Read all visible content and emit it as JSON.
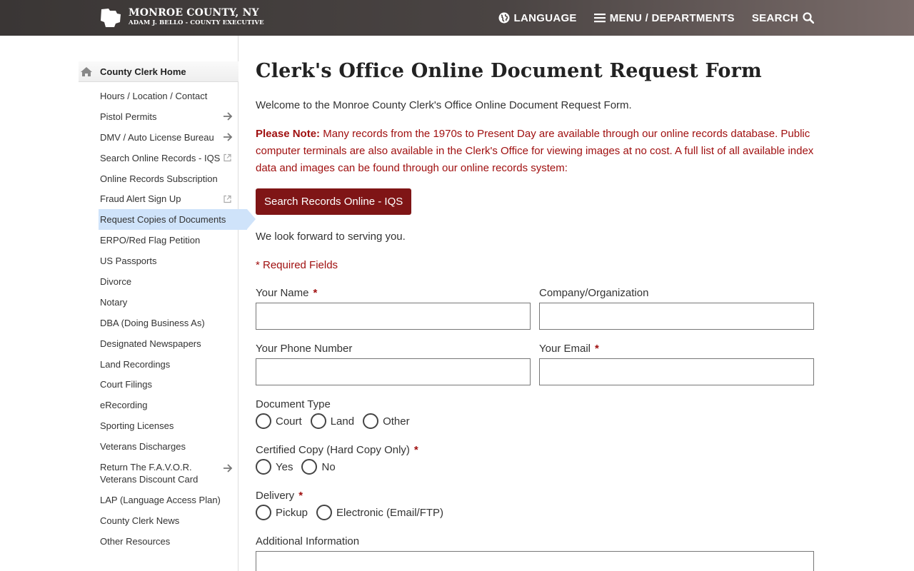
{
  "header": {
    "county": "MONROE COUNTY, NY",
    "executive": "ADAM J. BELLO - COUNTY EXECUTIVE",
    "language": "LANGUAGE",
    "menu": "MENU / DEPARTMENTS",
    "search": "SEARCH"
  },
  "sidebar": {
    "home": "County Clerk Home",
    "items": [
      {
        "label": "Hours / Location / Contact"
      },
      {
        "label": "Pistol Permits"
      },
      {
        "label": "DMV / Auto License Bureau"
      },
      {
        "label": "Search Online Records - IQS"
      },
      {
        "label": "Online Records Subscription"
      },
      {
        "label": "Fraud Alert Sign Up"
      },
      {
        "label": "Request Copies of Documents"
      },
      {
        "label": "ERPO/Red Flag Petition"
      },
      {
        "label": "US Passports"
      },
      {
        "label": "Divorce"
      },
      {
        "label": "Notary"
      },
      {
        "label": "DBA (Doing Business As)"
      },
      {
        "label": "Designated Newspapers"
      },
      {
        "label": "Land Recordings"
      },
      {
        "label": "Court Filings"
      },
      {
        "label": "eRecording"
      },
      {
        "label": "Sporting Licenses"
      },
      {
        "label": "Veterans Discharges"
      },
      {
        "label": "Return The F.A.V.O.R. Veterans Discount Card"
      },
      {
        "label": "LAP (Language Access Plan)"
      },
      {
        "label": "County Clerk News"
      },
      {
        "label": "Other Resources"
      }
    ]
  },
  "main": {
    "title": "Clerk's Office Online Document Request Form",
    "welcome": "Welcome to the Monroe County Clerk's Office Online Document Request Form.",
    "note_label": "Please Note:",
    "note_text": "Many records from the 1970s to Present Day are available through our online records database. Public computer terminals are also available in the Clerk's Office for viewing images at no cost. A full list of all available index data and images can be found through our online records system:",
    "search_button": "Search Records Online - IQS",
    "forward": "We look forward to serving you.",
    "required_note": "* Required Fields",
    "star": "*",
    "fields": {
      "name": "Your Name",
      "company": "Company/Organization",
      "phone": "Your Phone Number",
      "email": "Your Email",
      "doc_type": "Document Type",
      "doc_type_options": [
        "Court",
        "Land",
        "Other"
      ],
      "certified": "Certified Copy (Hard Copy Only)",
      "certified_options": [
        "Yes",
        "No"
      ],
      "delivery": "Delivery",
      "delivery_options": [
        "Pickup",
        "Electronic (Email/FTP)"
      ],
      "additional": "Additional Information"
    }
  },
  "colors": {
    "accent_red": "#7f1516",
    "note_red": "#a01010",
    "active_nav": "#cfe3fa"
  }
}
